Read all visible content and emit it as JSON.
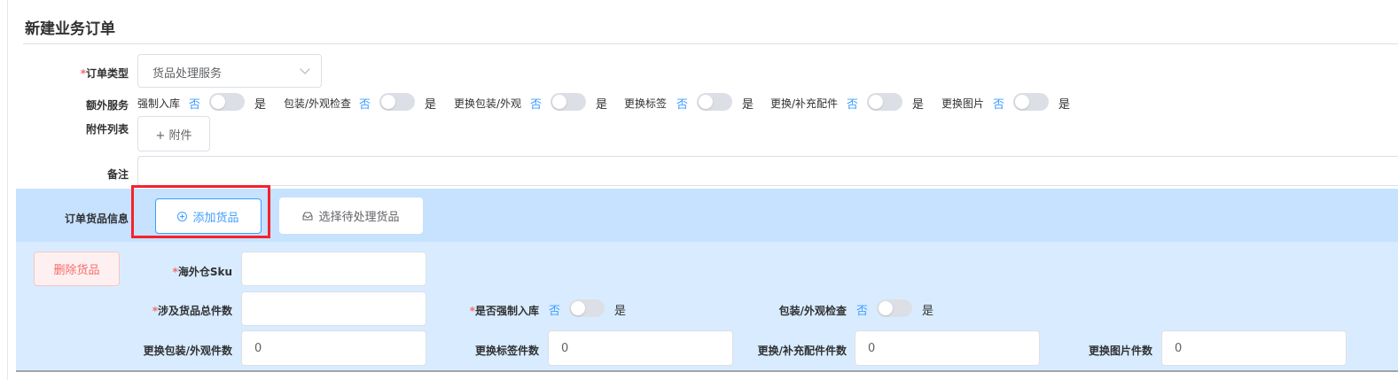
{
  "page": {
    "title": "新建业务订单"
  },
  "form": {
    "order_type": {
      "label": "订单类型",
      "value": "货品处理服务"
    },
    "extra_services": {
      "label": "额外服务",
      "no_label": "否",
      "yes_label": "是",
      "items": [
        {
          "label": "强制入库",
          "on": false
        },
        {
          "label": "包装/外观检查",
          "on": false
        },
        {
          "label": "更换包装/外观",
          "on": false
        },
        {
          "label": "更换标签",
          "on": false
        },
        {
          "label": "更换/补充配件",
          "on": false
        },
        {
          "label": "更换图片",
          "on": false
        }
      ]
    },
    "attachments": {
      "label": "附件列表",
      "button": "+ 附件"
    },
    "remark": {
      "label": "备注",
      "value": ""
    }
  },
  "goods": {
    "label": "订单货品信息",
    "add_button": "添加货品",
    "select_button": "选择待处理货品",
    "delete_button": "删除货品",
    "sku": {
      "label": "海外仓Sku",
      "value": ""
    },
    "total_count": {
      "label": "涉及货品总件数",
      "value": ""
    },
    "force_storage": {
      "label": "是否强制入库",
      "on": false
    },
    "package_check": {
      "label": "包装/外观检查",
      "on": false
    },
    "replace_package_count": {
      "label": "更换包装/外观件数",
      "value": "0"
    },
    "replace_label_count": {
      "label": "更换标签件数",
      "value": "0"
    },
    "replace_parts_count": {
      "label": "更换/补充配件件数",
      "value": "0"
    },
    "replace_image_count": {
      "label": "更换图片件数",
      "value": "0"
    }
  },
  "colors": {
    "accent": "#409eff",
    "danger": "#f56c6c",
    "band": "#c6e2ff",
    "band_light": "#d9ecff",
    "highlight": "#f5222d"
  }
}
